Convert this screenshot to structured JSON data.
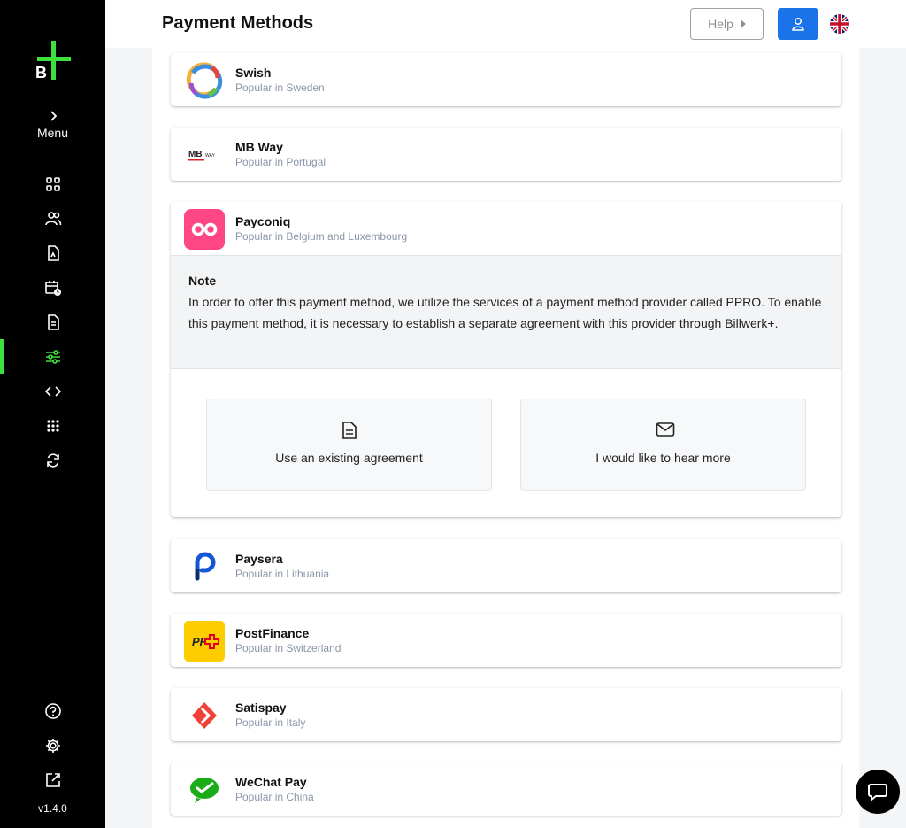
{
  "sidebar": {
    "logo_letter": "B",
    "menu_label": "Menu",
    "version": "v1.4.0",
    "nav_icons": [
      "dashboard-icon",
      "customers-icon",
      "invoices-icon",
      "subscriptions-icon",
      "documents-icon",
      "settings-sliders-icon",
      "code-icon",
      "apps-icon",
      "sync-icon"
    ],
    "bottom_icons": [
      "help-circle-icon",
      "gear-icon",
      "external-link-icon"
    ],
    "accent_color": "#3de03d"
  },
  "header": {
    "title": "Payment Methods",
    "help_label": "Help",
    "user_button_color": "#1a73e8"
  },
  "payment_methods": [
    {
      "name": "Swish",
      "subtitle": "Popular in Sweden"
    },
    {
      "name": "MB Way",
      "subtitle": "Popular in Portugal",
      "logo_text": "MB",
      "logo_small_text": "WAY"
    },
    {
      "name": "Payconiq",
      "subtitle": "Popular in Belgium and Luxembourg"
    },
    {
      "name": "Paysera",
      "subtitle": "Popular in Lithuania"
    },
    {
      "name": "PostFinance",
      "subtitle": "Popular in Switzerland",
      "logo_text": "PF"
    },
    {
      "name": "Satispay",
      "subtitle": "Popular in Italy"
    },
    {
      "name": "WeChat Pay",
      "subtitle": "Popular in China"
    }
  ],
  "expanded": {
    "note_title": "Note",
    "note_body": "In order to offer this payment method, we utilize the services of a payment method provider called PPRO. To enable this payment method, it is necessary to establish a separate agreement with this provider through Billwerk+.",
    "option_existing": "Use an existing agreement",
    "option_hear_more": "I would like to hear more"
  }
}
